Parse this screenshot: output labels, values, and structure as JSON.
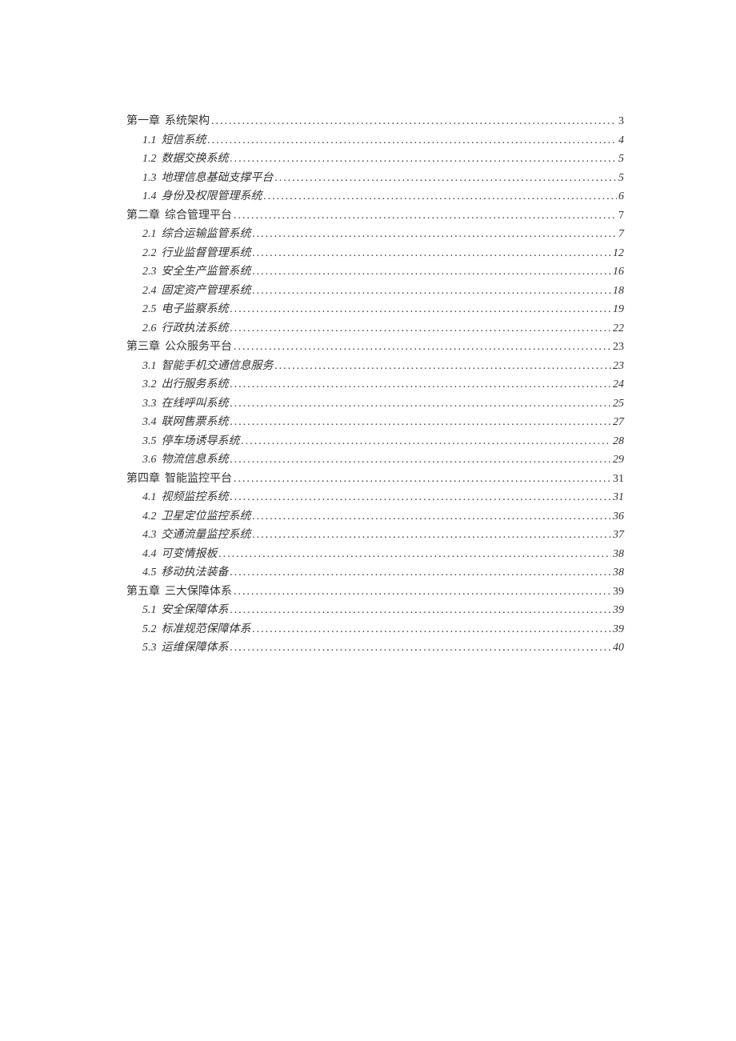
{
  "toc": [
    {
      "level": "chapter",
      "num": "第一章",
      "title": "系统架构",
      "page": "3"
    },
    {
      "level": "section",
      "num": "1.1",
      "title": "短信系统",
      "page": "4"
    },
    {
      "level": "section",
      "num": "1.2",
      "title": "数据交换系统",
      "page": "5"
    },
    {
      "level": "section",
      "num": "1.3",
      "title": "地理信息基础支撑平台",
      "page": "5"
    },
    {
      "level": "section",
      "num": "1.4",
      "title": "身份及权限管理系统",
      "page": "6"
    },
    {
      "level": "chapter",
      "num": "第二章",
      "title": "综合管理平台",
      "page": "7"
    },
    {
      "level": "section",
      "num": "2.1",
      "title": "综合运输监管系统",
      "page": "7"
    },
    {
      "level": "section",
      "num": "2.2",
      "title": "行业监督管理系统",
      "page": "12"
    },
    {
      "level": "section",
      "num": "2.3",
      "title": "安全生产监管系统",
      "page": "16"
    },
    {
      "level": "section",
      "num": "2.4",
      "title": "固定资产管理系统",
      "page": "18"
    },
    {
      "level": "section",
      "num": "2.5",
      "title": "电子监察系统",
      "page": "19"
    },
    {
      "level": "section",
      "num": "2.6",
      "title": "行政执法系统",
      "page": "22"
    },
    {
      "level": "chapter",
      "num": "第三章",
      "title": "公众服务平台",
      "page": "23"
    },
    {
      "level": "section",
      "num": "3.1",
      "title": "智能手机交通信息服务",
      "page": "23"
    },
    {
      "level": "section",
      "num": "3.2",
      "title": "出行服务系统",
      "page": "24"
    },
    {
      "level": "section",
      "num": "3.3",
      "title": "在线呼叫系统",
      "page": "25"
    },
    {
      "level": "section",
      "num": "3.4",
      "title": "联网售票系统",
      "page": "27"
    },
    {
      "level": "section",
      "num": "3.5",
      "title": "停车场诱导系统",
      "page": "28"
    },
    {
      "level": "section",
      "num": "3.6",
      "title": "物流信息系统",
      "page": "29"
    },
    {
      "level": "chapter",
      "num": "第四章",
      "title": "智能监控平台",
      "page": "31"
    },
    {
      "level": "section",
      "num": "4.1",
      "title": "视频监控系统",
      "page": "31"
    },
    {
      "level": "section",
      "num": "4.2",
      "title": "卫星定位监控系统",
      "page": "36"
    },
    {
      "level": "section",
      "num": "4.3",
      "title": "交通流量监控系统",
      "page": "37"
    },
    {
      "level": "section",
      "num": "4.4",
      "title": "可变情报板",
      "page": "38"
    },
    {
      "level": "section",
      "num": "4.5",
      "title": "移动执法装备",
      "page": "38"
    },
    {
      "level": "chapter",
      "num": "第五章",
      "title": "三大保障体系",
      "page": "39"
    },
    {
      "level": "section",
      "num": "5.1",
      "title": "安全保障体系",
      "page": "39"
    },
    {
      "level": "section",
      "num": "5.2",
      "title": "标准规范保障体系",
      "page": "39"
    },
    {
      "level": "section",
      "num": "5.3",
      "title": "运维保障体系",
      "page": "40"
    }
  ],
  "dots": "........................................................................................................................................"
}
